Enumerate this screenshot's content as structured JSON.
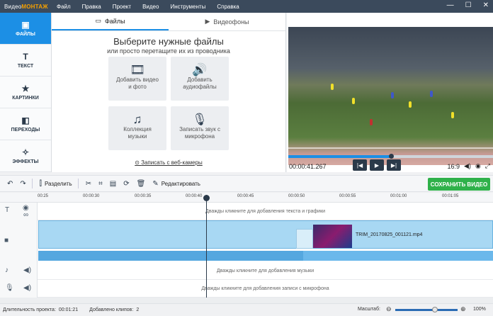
{
  "app": {
    "logo_prefix": "Видео",
    "logo_brand": "МОНТАЖ",
    "menu": [
      "Файл",
      "Правка",
      "Проект",
      "Видео",
      "Инструменты",
      "Справка"
    ],
    "window_buttons": [
      "—",
      "☐",
      "✕"
    ]
  },
  "sidebar": {
    "items": [
      {
        "label": "ФАЙЛЫ",
        "icon": "files-icon"
      },
      {
        "label": "ТЕКСТ",
        "icon": "text-icon"
      },
      {
        "label": "КАРТИНКИ",
        "icon": "star-icon"
      },
      {
        "label": "ПЕРЕХОДЫ",
        "icon": "transitions-icon"
      },
      {
        "label": "ЭФФЕКТЫ",
        "icon": "effects-icon"
      }
    ]
  },
  "files_panel": {
    "tabs": [
      "Файлы",
      "Видеофоны"
    ],
    "title": "Выберите нужные файлы",
    "subtitle": "или просто перетащите их из проводника",
    "tiles": [
      {
        "label": "Добавить видео и фото",
        "icon": "film-icon"
      },
      {
        "label": "Добавить аудиофайлы",
        "icon": "audio-file-icon"
      },
      {
        "label": "Коллекция музыки",
        "icon": "music-icon"
      },
      {
        "label": "Записать звук с микрофона",
        "icon": "microphone-icon"
      }
    ],
    "webcam": "Записать с веб-камеры"
  },
  "player": {
    "time": "00:00:41.267",
    "aspect": "16:9",
    "progress": 0.5
  },
  "toolbar": {
    "split": "Разделить",
    "edit": "Редактировать",
    "save": "СОХРАНИТЬ ВИДЕО"
  },
  "ruler": {
    "ticks": [
      "00:25",
      "00:00:30",
      "00:00:35",
      "00:00:40",
      "00:00:45",
      "00:00:50",
      "00:00:55",
      "00:01:00",
      "00:01:05"
    ]
  },
  "timeline": {
    "text_hint": "Дважды кликните для добавления текста и графики",
    "clip_name": "TRIM_20170825_001121.mp4",
    "music_hint": "Дважды кликните для добавления музыки",
    "mic_hint": "Дважды кликните для добавления записи с микрофона"
  },
  "status": {
    "duration_label": "Длительность проекта:",
    "duration": "00:01:21",
    "clips_label": "Добавлено клипов:",
    "clips": "2",
    "zoom_label": "Масштаб:",
    "zoom": "100%"
  }
}
